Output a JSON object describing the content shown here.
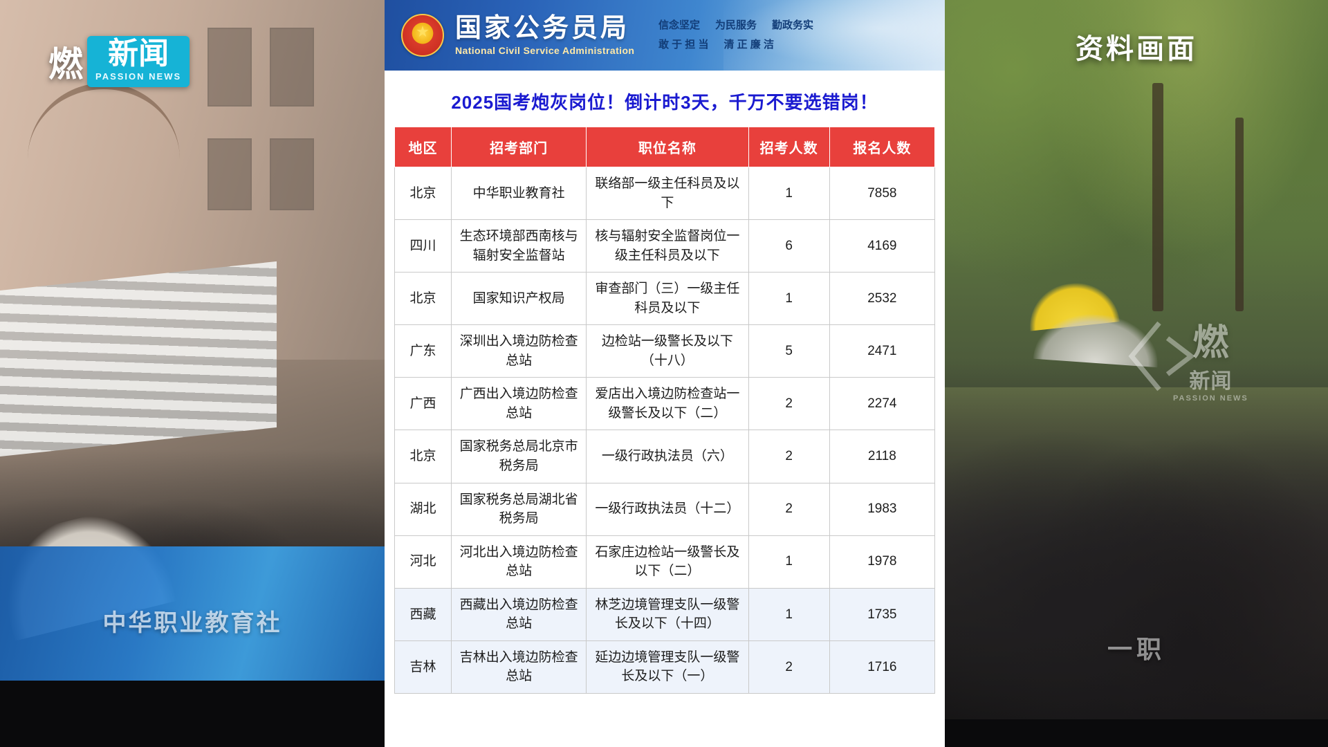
{
  "left_panel": {
    "logo": {
      "mark": "燃",
      "brand_cn": "新闻",
      "brand_en": "PASSION NEWS"
    },
    "overlay_text": "中华职业教育社"
  },
  "document": {
    "header": {
      "org_name_cn": "国家公务员局",
      "org_name_en": "National Civil Service Administration",
      "emblem_icon": "national-emblem-icon",
      "slogan_line1_left": "信念坚定",
      "slogan_line1_mid": "为民服务",
      "slogan_line1_right": "勤政务实",
      "slogan_line2_left": "敢 于 担 当",
      "slogan_line2_right": "清 正 廉 洁"
    },
    "title": "2025国考炮灰岗位！倒计时3天，千万不要选错岗！",
    "table": {
      "columns": [
        "地区",
        "招考部门",
        "职位名称",
        "招考人数",
        "报名人数"
      ],
      "rows": [
        {
          "region": "北京",
          "dept": "中华职业教育社",
          "post": "联络部一级主任科员及以下",
          "hire": "1",
          "apply": "7858",
          "highlight": false
        },
        {
          "region": "四川",
          "dept": "生态环境部西南核与辐射安全监督站",
          "post": "核与辐射安全监督岗位一级主任科员及以下",
          "hire": "6",
          "apply": "4169",
          "highlight": false
        },
        {
          "region": "北京",
          "dept": "国家知识产权局",
          "post": "审查部门（三）一级主任科员及以下",
          "hire": "1",
          "apply": "2532",
          "highlight": false
        },
        {
          "region": "广东",
          "dept": "深圳出入境边防检查总站",
          "post": "边检站一级警长及以下（十八）",
          "hire": "5",
          "apply": "2471",
          "highlight": false
        },
        {
          "region": "广西",
          "dept": "广西出入境边防检查总站",
          "post": "爱店出入境边防检查站一级警长及以下（二）",
          "hire": "2",
          "apply": "2274",
          "highlight": false
        },
        {
          "region": "北京",
          "dept": "国家税务总局北京市税务局",
          "post": "一级行政执法员（六）",
          "hire": "2",
          "apply": "2118",
          "highlight": false
        },
        {
          "region": "湖北",
          "dept": "国家税务总局湖北省税务局",
          "post": "一级行政执法员（十二）",
          "hire": "2",
          "apply": "1983",
          "highlight": false
        },
        {
          "region": "河北",
          "dept": "河北出入境边防检查总站",
          "post": "石家庄边检站一级警长及以下（二）",
          "hire": "1",
          "apply": "1978",
          "highlight": false
        },
        {
          "region": "西藏",
          "dept": "西藏出入境边防检查总站",
          "post": "林芝边境管理支队一级警长及以下（十四）",
          "hire": "1",
          "apply": "1735",
          "highlight": true
        },
        {
          "region": "吉林",
          "dept": "吉林出入境边防检查总站",
          "post": "延边边境管理支队一级警长及以下（一）",
          "hire": "2",
          "apply": "1716",
          "highlight": true
        }
      ]
    }
  },
  "right_panel": {
    "caption": "资料画面",
    "subtitle": "一职",
    "watermark": {
      "mark": "燃",
      "brand_cn": "新闻",
      "brand_en": "PASSION NEWS"
    }
  },
  "colors": {
    "table_header_bg": "#e8403c",
    "title_color": "#1a1ad0",
    "header_blue": "#2a63b8",
    "logo_cyan": "#16b3d6",
    "row_highlight": "#eef3fb"
  }
}
